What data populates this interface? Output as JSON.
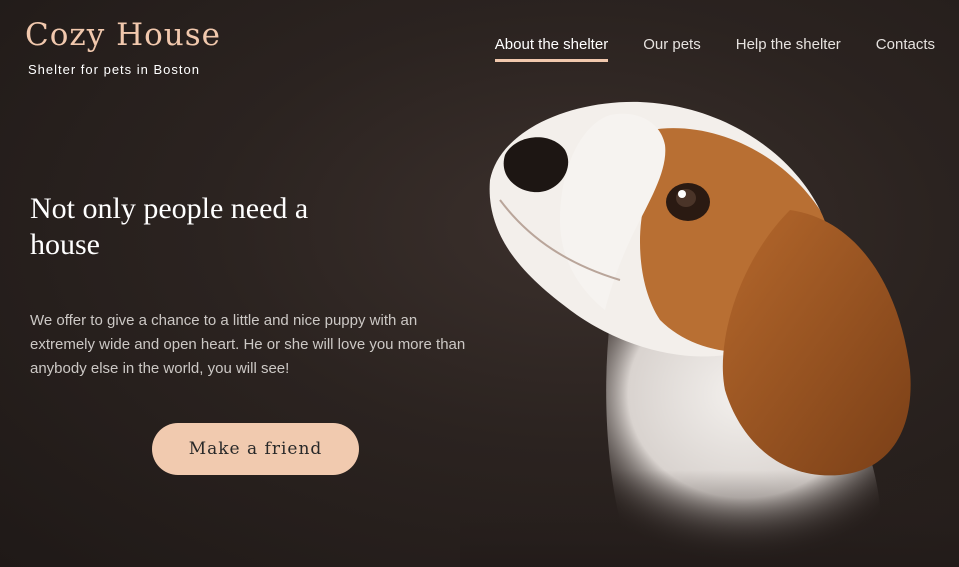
{
  "logo": {
    "title": "Cozy House",
    "subtitle": "Shelter for pets in Boston"
  },
  "nav": {
    "items": [
      {
        "label": "About the shelter",
        "active": true
      },
      {
        "label": "Our pets",
        "active": false
      },
      {
        "label": "Help the shelter",
        "active": false
      },
      {
        "label": "Contacts",
        "active": false
      }
    ]
  },
  "hero": {
    "title": "Not only people need a house",
    "text": "We offer to give a chance to a little and nice puppy with an extremely wide and open heart. He or she will love you more than anybody else in the world, you will see!",
    "button_label": "Make a friend"
  },
  "colors": {
    "accent": "#f1cdb3",
    "background": "#292929",
    "text_light": "#cdcdcd"
  },
  "images": {
    "hero": "beagle-puppy-photo"
  }
}
